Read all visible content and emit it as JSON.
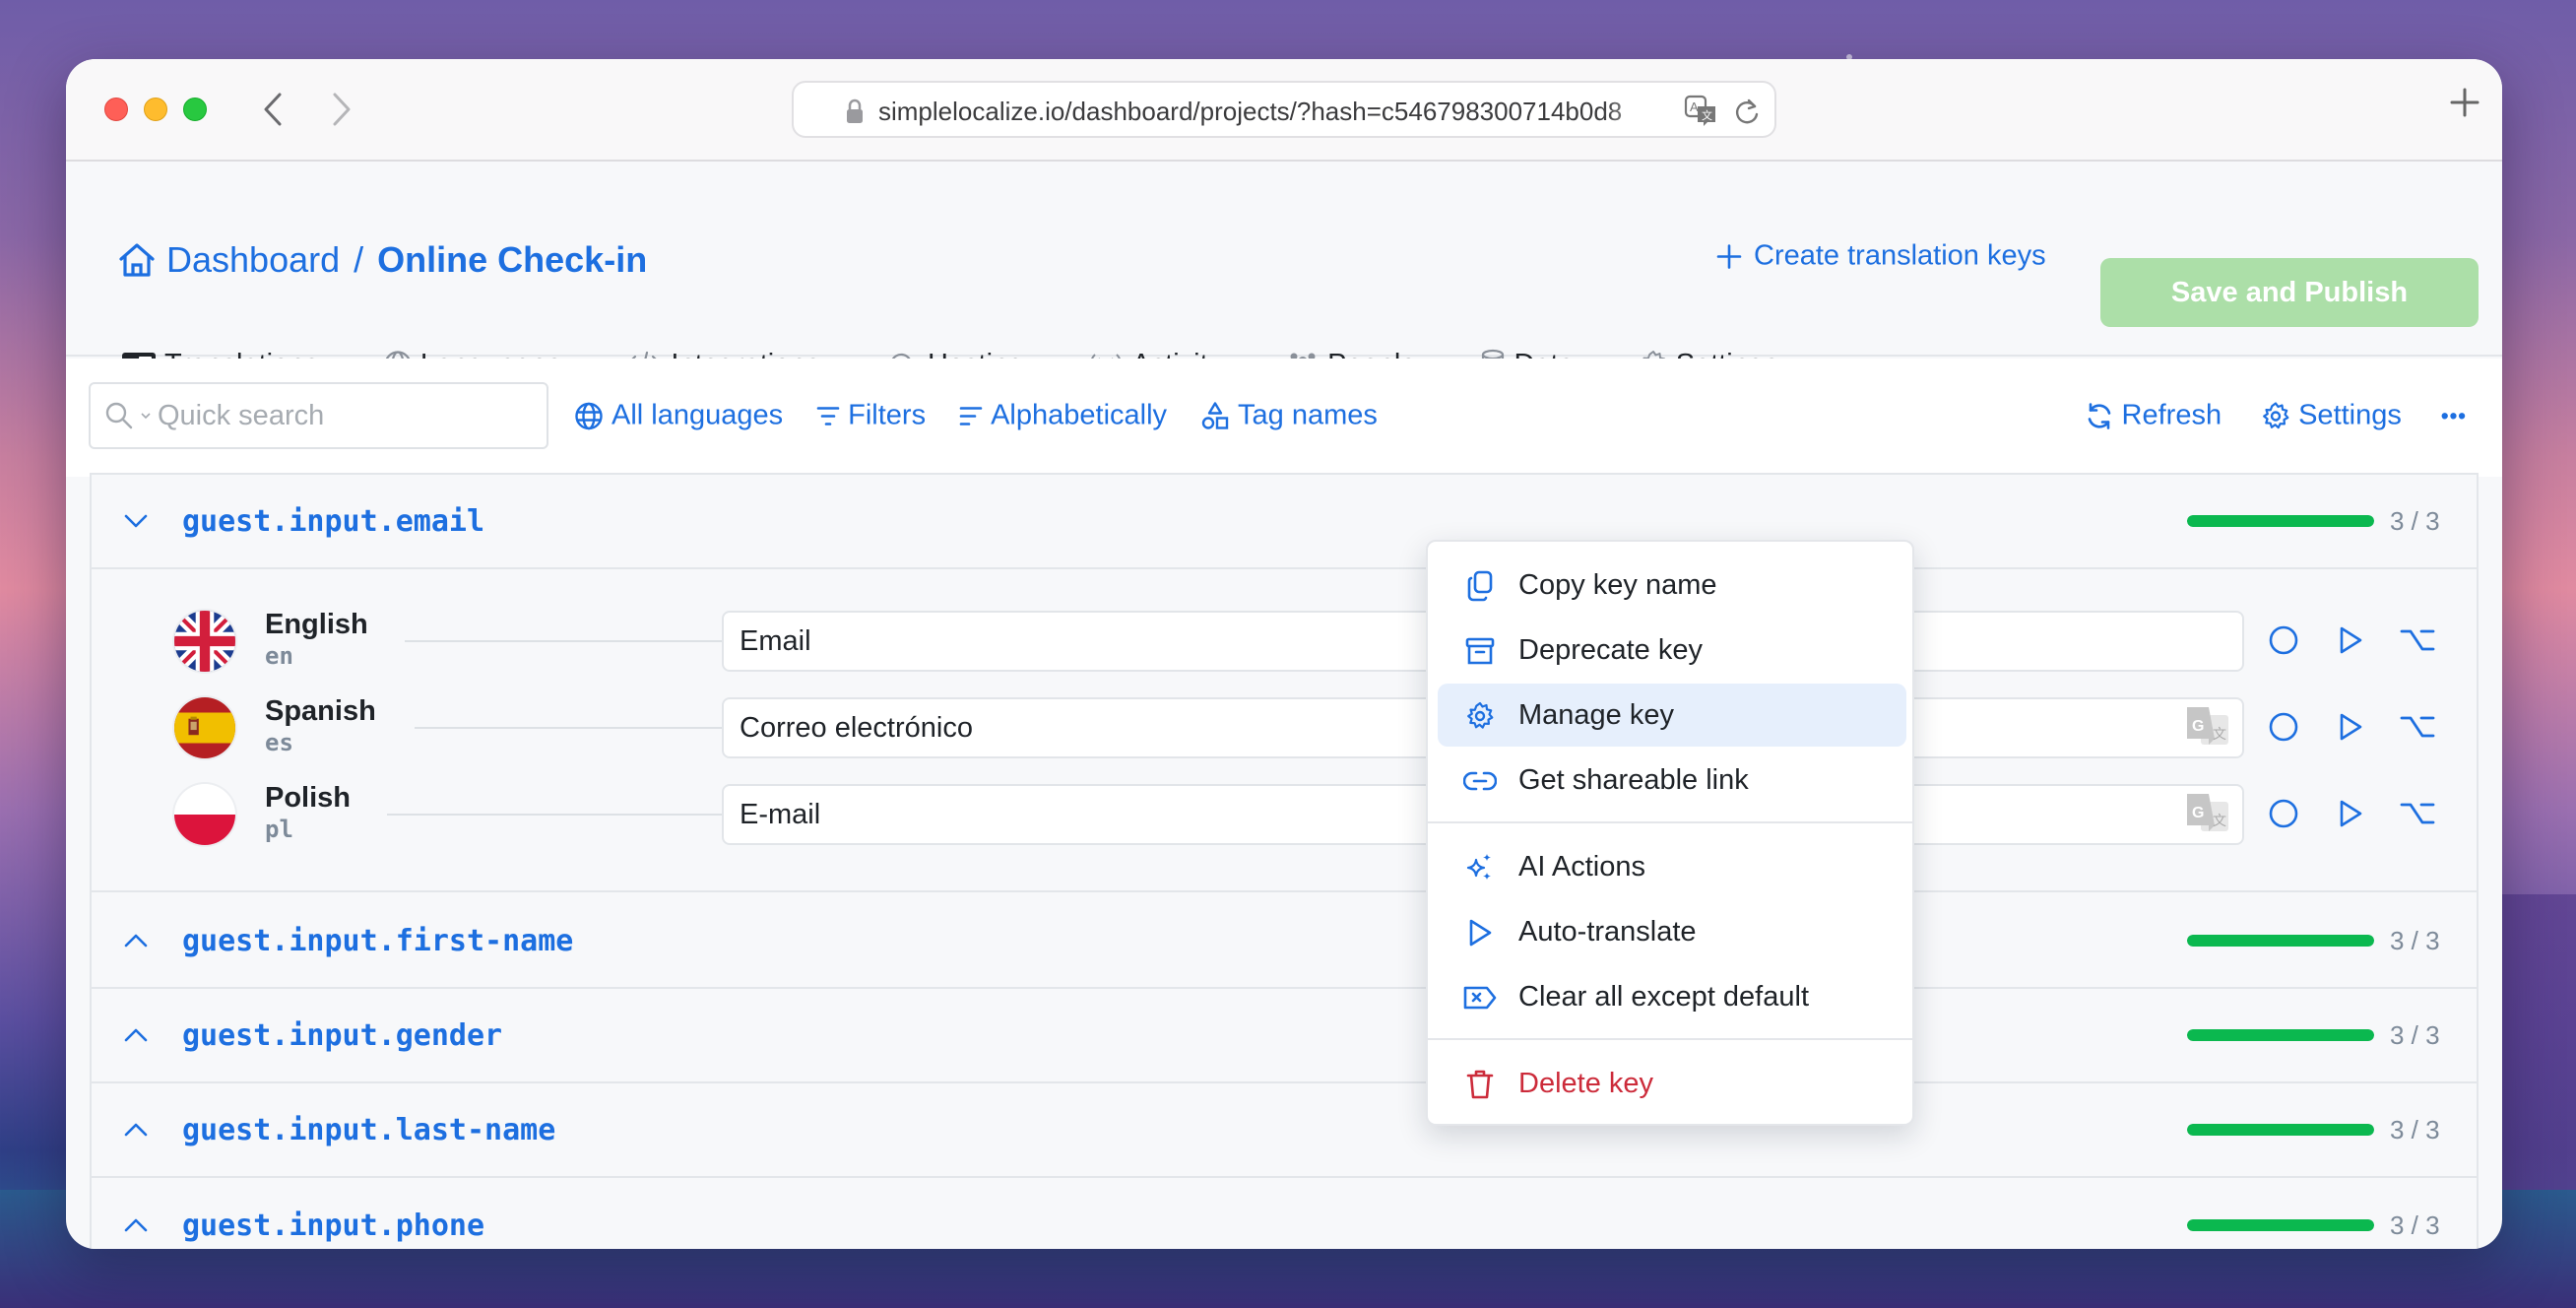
{
  "browser": {
    "url": "simplelocalize.io/dashboard/projects/?hash=c546798300714b0d8"
  },
  "header": {
    "breadcrumb": {
      "root": "Dashboard",
      "separator": "/",
      "current": "Online Check-in"
    },
    "create_keys_label": "Create translation keys",
    "save_label": "Save and Publish"
  },
  "tabs": [
    {
      "label": "Translations",
      "icon": "translate-icon",
      "active": true
    },
    {
      "label": "Languages",
      "icon": "globe-icon"
    },
    {
      "label": "Integrations",
      "icon": "code-icon"
    },
    {
      "label": "Hosting",
      "icon": "cloud-icon"
    },
    {
      "label": "Activity",
      "icon": "broadcast-icon"
    },
    {
      "label": "People",
      "icon": "people-icon"
    },
    {
      "label": "Data",
      "icon": "database-icon"
    },
    {
      "label": "Settings",
      "icon": "gear-icon"
    }
  ],
  "filterbar": {
    "search_placeholder": "Quick search",
    "search_value": "",
    "links": [
      {
        "label": "All languages",
        "icon": "globe-icon"
      },
      {
        "label": "Filters",
        "icon": "filter-icon"
      },
      {
        "label": "Alphabetically",
        "icon": "sort-icon"
      },
      {
        "label": "Tag names",
        "icon": "tags-icon"
      }
    ],
    "refresh_label": "Refresh",
    "settings_label": "Settings",
    "more_label": "•••"
  },
  "keys": [
    {
      "name": "guest.input.email",
      "expanded": true,
      "progress": {
        "done": 3,
        "total": 3,
        "label": "3 / 3"
      },
      "translations": [
        {
          "language": "English",
          "code": "en",
          "value": "Email",
          "flag": "uk",
          "auto_translate_icon": false
        },
        {
          "language": "Spanish",
          "code": "es",
          "value": "Correo electrónico",
          "flag": "es",
          "auto_translate_icon": true
        },
        {
          "language": "Polish",
          "code": "pl",
          "value": "E-mail",
          "flag": "pl",
          "auto_translate_icon": true
        }
      ]
    },
    {
      "name": "guest.input.first-name",
      "expanded": false,
      "progress": {
        "done": 3,
        "total": 3,
        "label": "3 / 3"
      }
    },
    {
      "name": "guest.input.gender",
      "expanded": false,
      "progress": {
        "done": 3,
        "total": 3,
        "label": "3 / 3"
      }
    },
    {
      "name": "guest.input.last-name",
      "expanded": false,
      "progress": {
        "done": 3,
        "total": 3,
        "label": "3 / 3"
      }
    },
    {
      "name": "guest.input.phone",
      "expanded": false,
      "progress": {
        "done": 3,
        "total": 3,
        "label": "3 / 3"
      }
    }
  ],
  "context_menu": {
    "items": [
      {
        "label": "Copy key name",
        "icon": "copy-icon"
      },
      {
        "label": "Deprecate key",
        "icon": "archive-icon"
      },
      {
        "label": "Manage key",
        "icon": "gear-icon",
        "highlighted": true
      },
      {
        "label": "Get shareable link",
        "icon": "link-icon"
      },
      {
        "label": "AI Actions",
        "icon": "sparkles-icon"
      },
      {
        "label": "Auto-translate",
        "icon": "play-icon"
      },
      {
        "label": "Clear all except default",
        "icon": "clear-tag-icon"
      },
      {
        "label": "Delete key",
        "icon": "trash-icon",
        "danger": true
      }
    ]
  },
  "colors": {
    "accent": "#1d6fe0",
    "success": "#0bb84f",
    "danger": "#cc2b3a",
    "save_disabled": "#acdfa8",
    "menu_highlight": "#e6effc"
  }
}
